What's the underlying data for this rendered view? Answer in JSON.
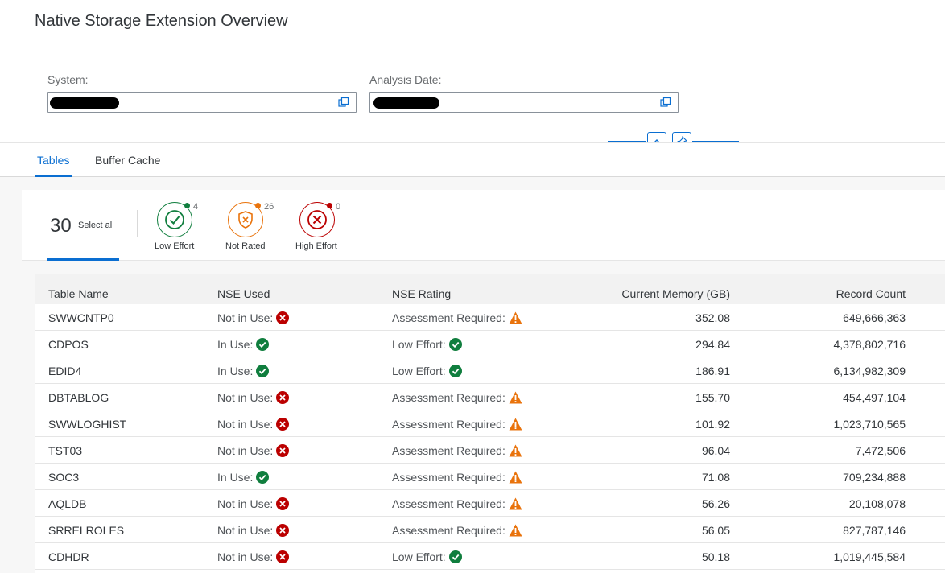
{
  "page": {
    "title": "Native Storage Extension Overview"
  },
  "filters": {
    "system": {
      "label": "System:",
      "value": ""
    },
    "analysis_date": {
      "label": "Analysis Date:",
      "value": ""
    }
  },
  "tabs": [
    {
      "label": "Tables",
      "active": true
    },
    {
      "label": "Buffer Cache",
      "active": false
    }
  ],
  "icon_filters": {
    "total": {
      "count": "30",
      "label": "Select all"
    },
    "items": [
      {
        "label": "Low Effort",
        "count": "4",
        "color": "#107e3e",
        "icon": "check-circle-icon"
      },
      {
        "label": "Not Rated",
        "count": "26",
        "color": "#e9730c",
        "icon": "shield-x-icon"
      },
      {
        "label": "High Effort",
        "count": "0",
        "color": "#bb0000",
        "icon": "x-circle-icon"
      }
    ]
  },
  "table": {
    "columns": [
      "Table Name",
      "NSE Used",
      "NSE Rating",
      "Current Memory (GB)",
      "Record Count"
    ],
    "rows": [
      {
        "name": "SWWCNTP0",
        "used": "Not in Use:",
        "used_status": "error",
        "rating": "Assessment Required:",
        "rating_status": "warning",
        "memory": "352.08",
        "records": "649,666,363"
      },
      {
        "name": "CDPOS",
        "used": "In Use:",
        "used_status": "success",
        "rating": "Low Effort:",
        "rating_status": "success",
        "memory": "294.84",
        "records": "4,378,802,716"
      },
      {
        "name": "EDID4",
        "used": "In Use:",
        "used_status": "success",
        "rating": "Low Effort:",
        "rating_status": "success",
        "memory": "186.91",
        "records": "6,134,982,309"
      },
      {
        "name": "DBTABLOG",
        "used": "Not in Use:",
        "used_status": "error",
        "rating": "Assessment Required:",
        "rating_status": "warning",
        "memory": "155.70",
        "records": "454,497,104"
      },
      {
        "name": "SWWLOGHIST",
        "used": "Not in Use:",
        "used_status": "error",
        "rating": "Assessment Required:",
        "rating_status": "warning",
        "memory": "101.92",
        "records": "1,023,710,565"
      },
      {
        "name": "TST03",
        "used": "Not in Use:",
        "used_status": "error",
        "rating": "Assessment Required:",
        "rating_status": "warning",
        "memory": "96.04",
        "records": "7,472,506"
      },
      {
        "name": "SOC3",
        "used": "In Use:",
        "used_status": "success",
        "rating": "Assessment Required:",
        "rating_status": "warning",
        "memory": "71.08",
        "records": "709,234,888"
      },
      {
        "name": "AQLDB",
        "used": "Not in Use:",
        "used_status": "error",
        "rating": "Assessment Required:",
        "rating_status": "warning",
        "memory": "56.26",
        "records": "20,108,078"
      },
      {
        "name": "SRRELROLES",
        "used": "Not in Use:",
        "used_status": "error",
        "rating": "Assessment Required:",
        "rating_status": "warning",
        "memory": "56.05",
        "records": "827,787,146"
      },
      {
        "name": "CDHDR",
        "used": "Not in Use:",
        "used_status": "error",
        "rating": "Low Effort:",
        "rating_status": "success",
        "memory": "50.18",
        "records": "1,019,445,584"
      }
    ]
  },
  "colors": {
    "accent": "#0a6ed1",
    "success": "#107e3e",
    "warning": "#e9730c",
    "error": "#bb0000"
  }
}
